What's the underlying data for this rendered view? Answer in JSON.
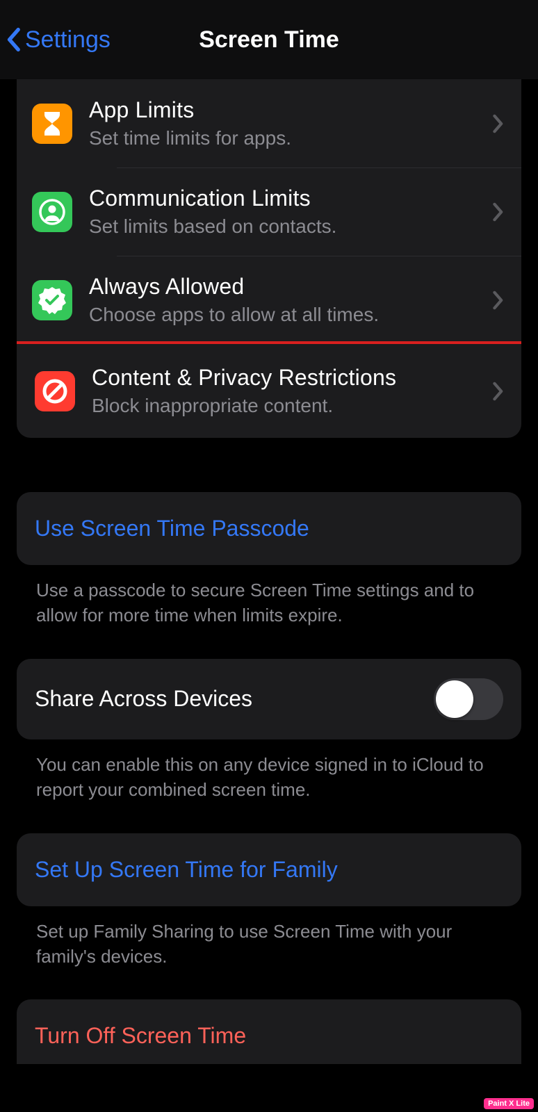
{
  "nav": {
    "back_label": "Settings",
    "title": "Screen Time"
  },
  "rows": {
    "app_limits": {
      "title": "App Limits",
      "sub": "Set time limits for apps."
    },
    "comm_limits": {
      "title": "Communication Limits",
      "sub": "Set limits based on contacts."
    },
    "always_allowed": {
      "title": "Always Allowed",
      "sub": "Choose apps to allow at all times."
    },
    "content_privacy": {
      "title": "Content & Privacy Restrictions",
      "sub": "Block inappropriate content."
    }
  },
  "passcode": {
    "link": "Use Screen Time Passcode",
    "footer": "Use a passcode to secure Screen Time settings and to allow for more time when limits expire."
  },
  "share": {
    "label": "Share Across Devices",
    "footer": "You can enable this on any device signed in to iCloud to report your combined screen time."
  },
  "family": {
    "link": "Set Up Screen Time for Family",
    "footer": "Set up Family Sharing to use Screen Time with your family's devices."
  },
  "turn_off": {
    "label": "Turn Off Screen Time"
  },
  "watermark": "Paint X Lite"
}
